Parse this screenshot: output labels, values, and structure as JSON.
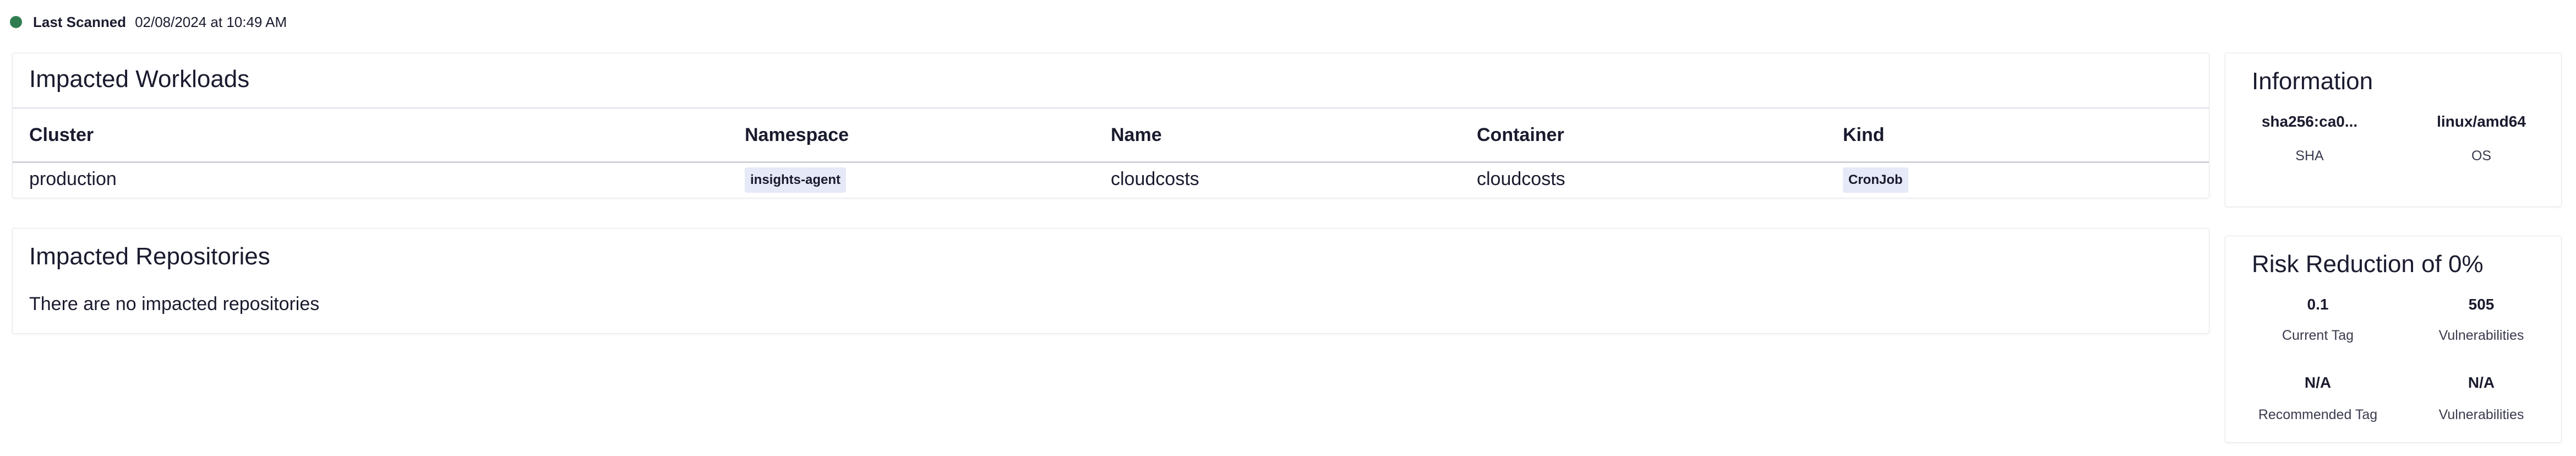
{
  "scan": {
    "label": "Last Scanned",
    "value": "02/08/2024 at 10:49 AM"
  },
  "workloads": {
    "title": "Impacted Workloads",
    "columns": [
      "Cluster",
      "Namespace",
      "Name",
      "Container",
      "Kind"
    ],
    "rows": [
      {
        "cluster": "production",
        "namespace": "insights-agent",
        "name": "cloudcosts",
        "container": "cloudcosts",
        "kind": "CronJob"
      }
    ]
  },
  "repositories": {
    "title": "Impacted Repositories",
    "empty_text": "There are no impacted repositories"
  },
  "information": {
    "title": "Information",
    "sha_value": "sha256:ca0...",
    "sha_label": "SHA",
    "os_value": "linux/amd64",
    "os_label": "OS"
  },
  "risk": {
    "title": "Risk Reduction of 0%",
    "current_tag_value": "0.1",
    "current_tag_label": "Current Tag",
    "current_vulns_value": "505",
    "current_vulns_label": "Vulnerabilities",
    "recommended_tag_value": "N/A",
    "recommended_tag_label": "Recommended Tag",
    "recommended_vulns_value": "N/A",
    "recommended_vulns_label": "Vulnerabilities"
  },
  "colors": {
    "status_dot": "#2f7d4f",
    "tag_background": "#e6e9f7",
    "text": "#1a1b2e"
  }
}
